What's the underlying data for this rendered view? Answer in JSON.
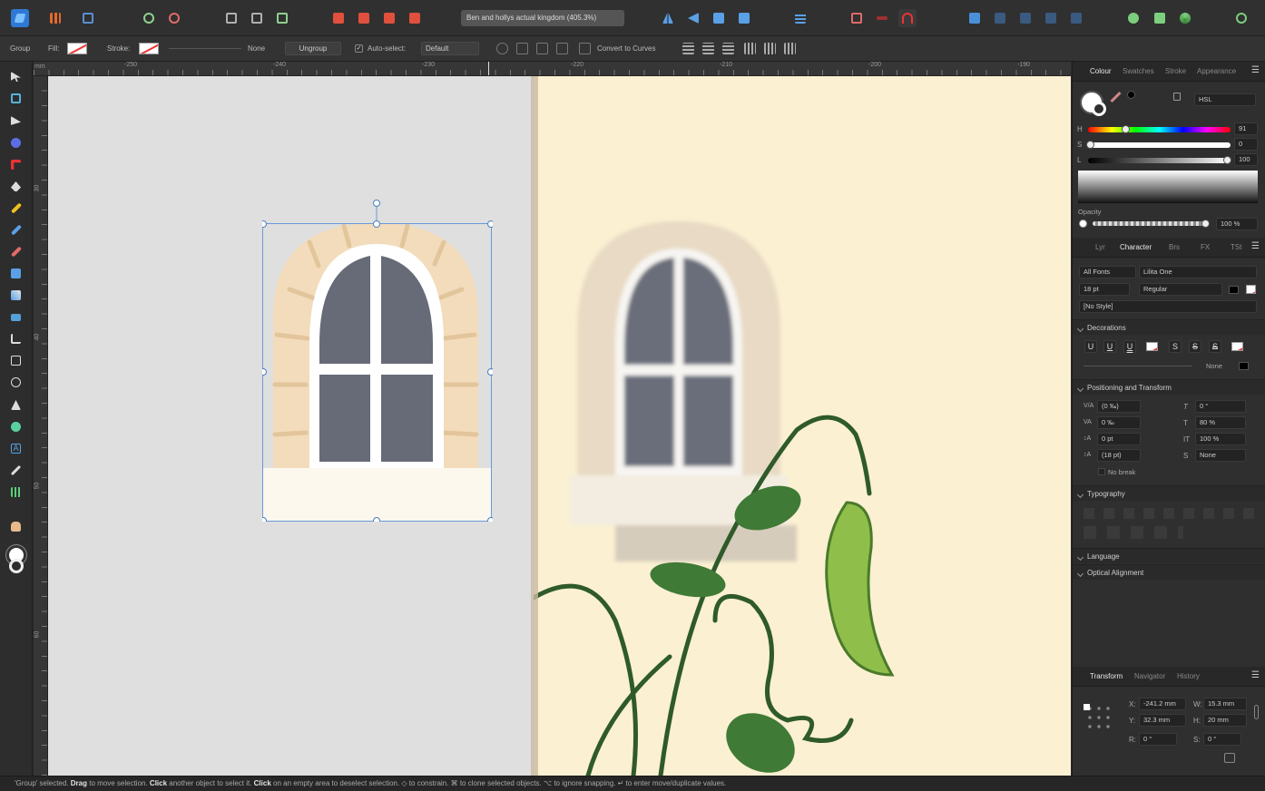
{
  "document": {
    "title": "Ben and hollys actual kingdom (405.3%)"
  },
  "context_bar": {
    "mode": "Group",
    "fill_label": "Fill:",
    "stroke_label": "Stroke:",
    "stroke_value": "None",
    "ungroup": "Ungroup",
    "autoselect_label": "Auto-select:",
    "autoselect_value": "Default",
    "convert": "Convert to Curves"
  },
  "ruler": {
    "unit": "mm",
    "top": [
      "-250",
      "-240",
      "-230",
      "-220",
      "-210",
      "-200",
      "-190"
    ],
    "left": [
      "30",
      "40",
      "50",
      "60"
    ]
  },
  "panel": {
    "colour_tabs": [
      "Colour",
      "Swatches",
      "Stroke",
      "Appearance"
    ],
    "colour_model": "HSL",
    "hsl": {
      "h_label": "H",
      "h": "91",
      "s_label": "S",
      "s": "0",
      "l_label": "L",
      "l": "100"
    },
    "opacity_label": "Opacity",
    "opacity": "100 %",
    "char_tabs": [
      "Lyr",
      "Character",
      "Brs",
      "FX",
      "TSt"
    ],
    "font_collection": "All Fonts",
    "font_family": "Lilita One",
    "font_size": "18 pt",
    "font_style": "Regular",
    "paragraph_style": "[No Style]",
    "decorations_title": "Decorations",
    "decoration_glyphs": [
      "U",
      "U",
      "U",
      "S",
      "S",
      "S"
    ],
    "decoration_none": "None",
    "positioning_title": "Positioning and Transform",
    "tracking": "(0 ‰)",
    "kerning": "0 ‰",
    "baseline": "0 pt",
    "leading": "(18 pt)",
    "shear": "0 °",
    "vscale": "80 %",
    "hscale": "100 %",
    "strike_none": "None",
    "no_break": "No break",
    "typography_title": "Typography",
    "language_title": "Language",
    "optical_title": "Optical Alignment",
    "transform_tabs": [
      "Transform",
      "Navigator",
      "History"
    ],
    "transform": {
      "x_label": "X:",
      "x": "-241.2 mm",
      "y_label": "Y:",
      "y": "32.3 mm",
      "w_label": "W:",
      "w": "15.3 mm",
      "h_label": "H:",
      "h": "20 mm",
      "r_label": "R:",
      "r": "0 °",
      "s_label": "S:",
      "s": "0 °"
    }
  },
  "status": {
    "s1": "'Group' selected. ",
    "b1": "Drag",
    "s2": " to move selection. ",
    "b2": "Click",
    "s3": " another object to select it. ",
    "b3": "Click",
    "s4": " on an empty area to deselect selection. ◇ to constrain. ⌘ to clone selected objects. ⌥ to ignore snapping. ↵ to enter move/duplicate values."
  },
  "colors": {
    "accent": "#4a90d9",
    "photo_bg": "#fbf0d2",
    "window_glass": "#6a6e7a",
    "stone": "#f3dcbb",
    "vine": "#2f5a2a"
  }
}
